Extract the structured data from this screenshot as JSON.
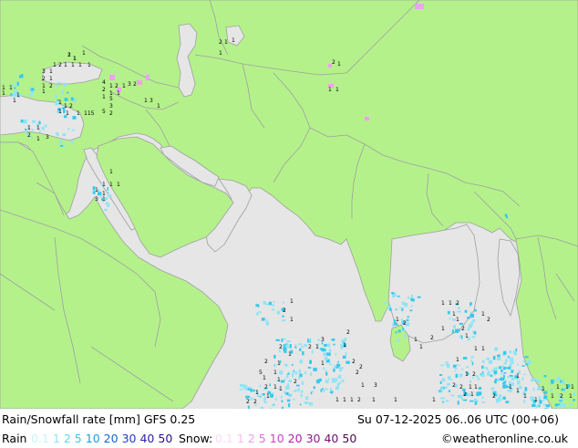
{
  "map": {
    "title": "Rain/Snowfall rate [mm] GFS 0.25",
    "datetime": "Su 07-12-2025 06..06 UTC (00+06)",
    "credit": "©weatheronline.co.uk",
    "colors": {
      "land": "#b5f18b",
      "sea": "#e6e6e6",
      "border": "#9ea0a0",
      "rain": "#5fd9f0",
      "snow": "#f0a0f0"
    }
  },
  "legend": {
    "rain_label": "Rain",
    "rain_values": [
      {
        "v": "0.1",
        "c": "#c7f3fa"
      },
      {
        "v": "1",
        "c": "#8fe4f5"
      },
      {
        "v": "2",
        "c": "#5fd9f0"
      },
      {
        "v": "5",
        "c": "#37c9ea"
      },
      {
        "v": "10",
        "c": "#1a9fe0"
      },
      {
        "v": "20",
        "c": "#1666d0"
      },
      {
        "v": "30",
        "c": "#1c3fbf"
      },
      {
        "v": "40",
        "c": "#2a1fa8"
      },
      {
        "v": "50",
        "c": "#2c0f8a"
      }
    ],
    "snow_label": "Snow:",
    "snow_values": [
      {
        "v": "0.1",
        "c": "#f7dcf7"
      },
      {
        "v": "1",
        "c": "#f2c0f2"
      },
      {
        "v": "2",
        "c": "#eaa0ea"
      },
      {
        "v": "5",
        "c": "#e070e0"
      },
      {
        "v": "10",
        "c": "#d040d0"
      },
      {
        "v": "20",
        "c": "#b020b0"
      },
      {
        "v": "30",
        "c": "#901890"
      },
      {
        "v": "40",
        "c": "#701070"
      },
      {
        "v": "50",
        "c": "#500a50"
      }
    ]
  },
  "labels": [
    "2",
    "1",
    "1",
    "1",
    "2",
    "1",
    "1",
    "1",
    "1",
    "2",
    "1",
    "3",
    "1",
    "1",
    "1",
    "1",
    "1",
    "1",
    "1",
    "2",
    "1",
    "4",
    "1",
    "2",
    "1",
    "3",
    "2",
    "2",
    "1",
    "1",
    "1",
    "5",
    "3",
    "1",
    "1",
    "2",
    "1",
    "1",
    "1",
    "115",
    "5",
    "2",
    "1",
    "3",
    "1",
    "1",
    "1",
    "2",
    "1",
    "3",
    "1",
    "1",
    "1",
    "1",
    "1",
    "1",
    "3",
    "1",
    "2",
    "1",
    "1",
    "1",
    "2",
    "1",
    "1",
    "1",
    "1",
    "2",
    "1",
    "2",
    "3",
    "2",
    "1",
    "2",
    "1",
    "2",
    "1",
    "1",
    "2",
    "5",
    "1",
    "1",
    "1",
    "2",
    "2",
    "1",
    "1",
    "1",
    "1",
    "2",
    "2",
    "1",
    "1",
    "1",
    "2",
    "1",
    "2",
    "1",
    "3",
    "1",
    "2",
    "1",
    "1",
    "2",
    "1",
    "1",
    "1",
    "2",
    "1",
    "1",
    "1",
    "2",
    "2",
    "1",
    "1",
    "1",
    "1",
    "1",
    "2",
    "2",
    "2",
    "1",
    "1",
    "2",
    "1",
    "1",
    "1",
    "1",
    "1",
    "2",
    "1",
    "1",
    "1",
    "1",
    "1",
    "2",
    "1",
    "1",
    "1",
    "1",
    "1",
    "2",
    "1",
    "1"
  ]
}
